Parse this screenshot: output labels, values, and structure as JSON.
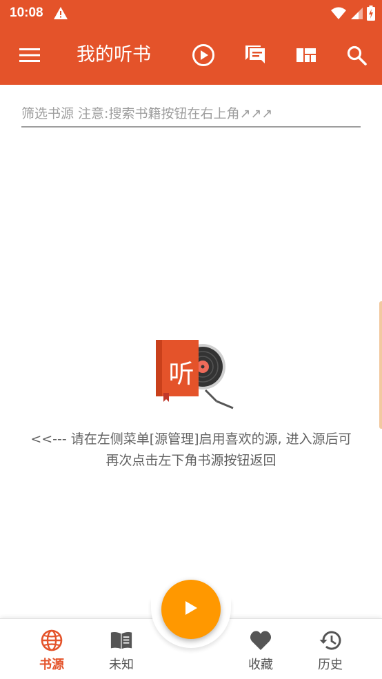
{
  "status_bar": {
    "time": "10:08"
  },
  "toolbar": {
    "title": "我的听书"
  },
  "filter": {
    "value": "",
    "placeholder": "筛选书源 注意:搜索书籍按钮在右上角↗↗↗"
  },
  "empty_state": {
    "logo_text": "听",
    "message_line1": "<<--- 请在左侧菜单[源管理]启用喜欢的源, 进入源后可",
    "message_line2": "再次点击左下角书源按钮返回"
  },
  "bottom_nav": {
    "items": [
      {
        "label": "书源",
        "icon": "globe-icon",
        "active": true
      },
      {
        "label": "未知",
        "icon": "book-icon",
        "active": false
      },
      {
        "label": "收藏",
        "icon": "heart-icon",
        "active": false
      },
      {
        "label": "历史",
        "icon": "history-icon",
        "active": false
      }
    ]
  },
  "colors": {
    "primary": "#e4532a",
    "fab": "#ff9800",
    "text_muted": "#9e9e9e"
  }
}
